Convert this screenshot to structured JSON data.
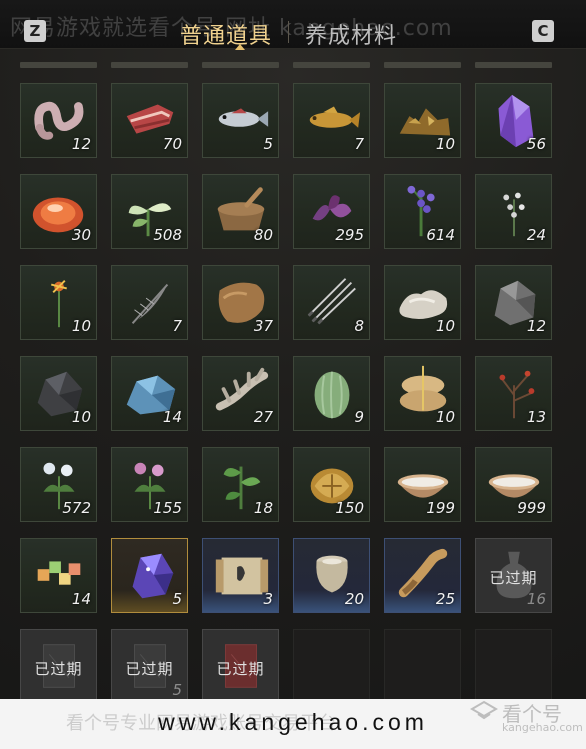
{
  "header": {
    "watermark": "网易游戏就选看个号 网址 kangehao.com",
    "left_key": "Z",
    "right_key": "C",
    "tabs": [
      {
        "label": "普通道具",
        "active": true
      },
      {
        "label": "养成材料",
        "active": false
      }
    ]
  },
  "items": [
    {
      "name": "intestines",
      "count": "12",
      "icon": "intestines-icon"
    },
    {
      "name": "meat",
      "count": "70",
      "icon": "meat-icon"
    },
    {
      "name": "fish",
      "count": "5",
      "icon": "fish-icon"
    },
    {
      "name": "carp",
      "count": "7",
      "icon": "carp-icon"
    },
    {
      "name": "ore-pile",
      "count": "10",
      "icon": "ore-pile-icon"
    },
    {
      "name": "amethyst",
      "count": "56",
      "icon": "amethyst-icon"
    },
    {
      "name": "red-gem",
      "count": "30",
      "icon": "red-gem-icon"
    },
    {
      "name": "white-herb",
      "count": "508",
      "icon": "white-herb-icon"
    },
    {
      "name": "mortar",
      "count": "80",
      "icon": "mortar-icon"
    },
    {
      "name": "purple-flower",
      "count": "295",
      "icon": "purple-flower-icon"
    },
    {
      "name": "lavender",
      "count": "614",
      "icon": "lavender-icon"
    },
    {
      "name": "small-white-flowers",
      "count": "24",
      "icon": "small-flowers-icon"
    },
    {
      "name": "red-flower",
      "count": "10",
      "icon": "red-flower-icon"
    },
    {
      "name": "feather",
      "count": "7",
      "icon": "feather-icon"
    },
    {
      "name": "fur",
      "count": "37",
      "icon": "fur-icon"
    },
    {
      "name": "quills",
      "count": "8",
      "icon": "quills-icon"
    },
    {
      "name": "wool",
      "count": "10",
      "icon": "wool-icon"
    },
    {
      "name": "grey-ore",
      "count": "12",
      "icon": "grey-ore-icon"
    },
    {
      "name": "dark-stone",
      "count": "10",
      "icon": "dark-stone-icon"
    },
    {
      "name": "blue-crystal",
      "count": "14",
      "icon": "blue-crystal-icon"
    },
    {
      "name": "bone",
      "count": "27",
      "icon": "bone-icon"
    },
    {
      "name": "melon",
      "count": "9",
      "icon": "melon-icon"
    },
    {
      "name": "sacks",
      "count": "10",
      "icon": "sacks-icon"
    },
    {
      "name": "red-berries",
      "count": "13",
      "icon": "berries-icon"
    },
    {
      "name": "white-flower-plant",
      "count": "572",
      "icon": "white-flower-plant-icon"
    },
    {
      "name": "pink-flower-plant",
      "count": "155",
      "icon": "pink-flower-plant-icon"
    },
    {
      "name": "green-sprout",
      "count": "18",
      "icon": "sprout-icon"
    },
    {
      "name": "gold-ornament",
      "count": "150",
      "icon": "gold-ornament-icon"
    },
    {
      "name": "milk-bowl",
      "count": "199",
      "icon": "bowl-icon"
    },
    {
      "name": "milk-bowl-large",
      "count": "999",
      "icon": "bowl-icon"
    },
    {
      "name": "candy",
      "count": "14",
      "icon": "candy-icon"
    },
    {
      "name": "purple-gem",
      "count": "5",
      "icon": "purple-gem-icon",
      "style": "gold"
    },
    {
      "name": "scroll",
      "count": "3",
      "icon": "scroll-icon",
      "style": "blue"
    },
    {
      "name": "jar",
      "count": "20",
      "icon": "jar-icon",
      "style": "blue"
    },
    {
      "name": "horn",
      "count": "25",
      "icon": "horn-icon",
      "style": "blue"
    },
    {
      "name": "expired-bottle",
      "count": "16",
      "label": "已过期",
      "icon": "bottle-icon",
      "style": "expired"
    },
    {
      "name": "expired-card-1",
      "count": "",
      "label": "已过期",
      "icon": "card-icon",
      "style": "expired"
    },
    {
      "name": "expired-card-2",
      "count": "5",
      "label": "已过期",
      "icon": "card-icon",
      "style": "expired"
    },
    {
      "name": "expired-red-card",
      "count": "",
      "label": "已过期",
      "icon": "red-card-icon",
      "style": "expired"
    },
    {
      "name": "empty-1",
      "count": "",
      "style": "empty"
    },
    {
      "name": "empty-2",
      "count": "",
      "style": "empty"
    },
    {
      "name": "empty-3",
      "count": "",
      "style": "empty"
    }
  ],
  "footer": {
    "website": "www.kangehao.com",
    "watermark": "看个号专业网易游戏账号交易平台",
    "logo_text": "看个号",
    "logo_sub": "kangehao.com"
  },
  "colors": {
    "tab_active": "#f0d28f",
    "tab_inactive": "#bcbcbc",
    "slot_bg": "#283028",
    "expired_bg": "#303030"
  }
}
